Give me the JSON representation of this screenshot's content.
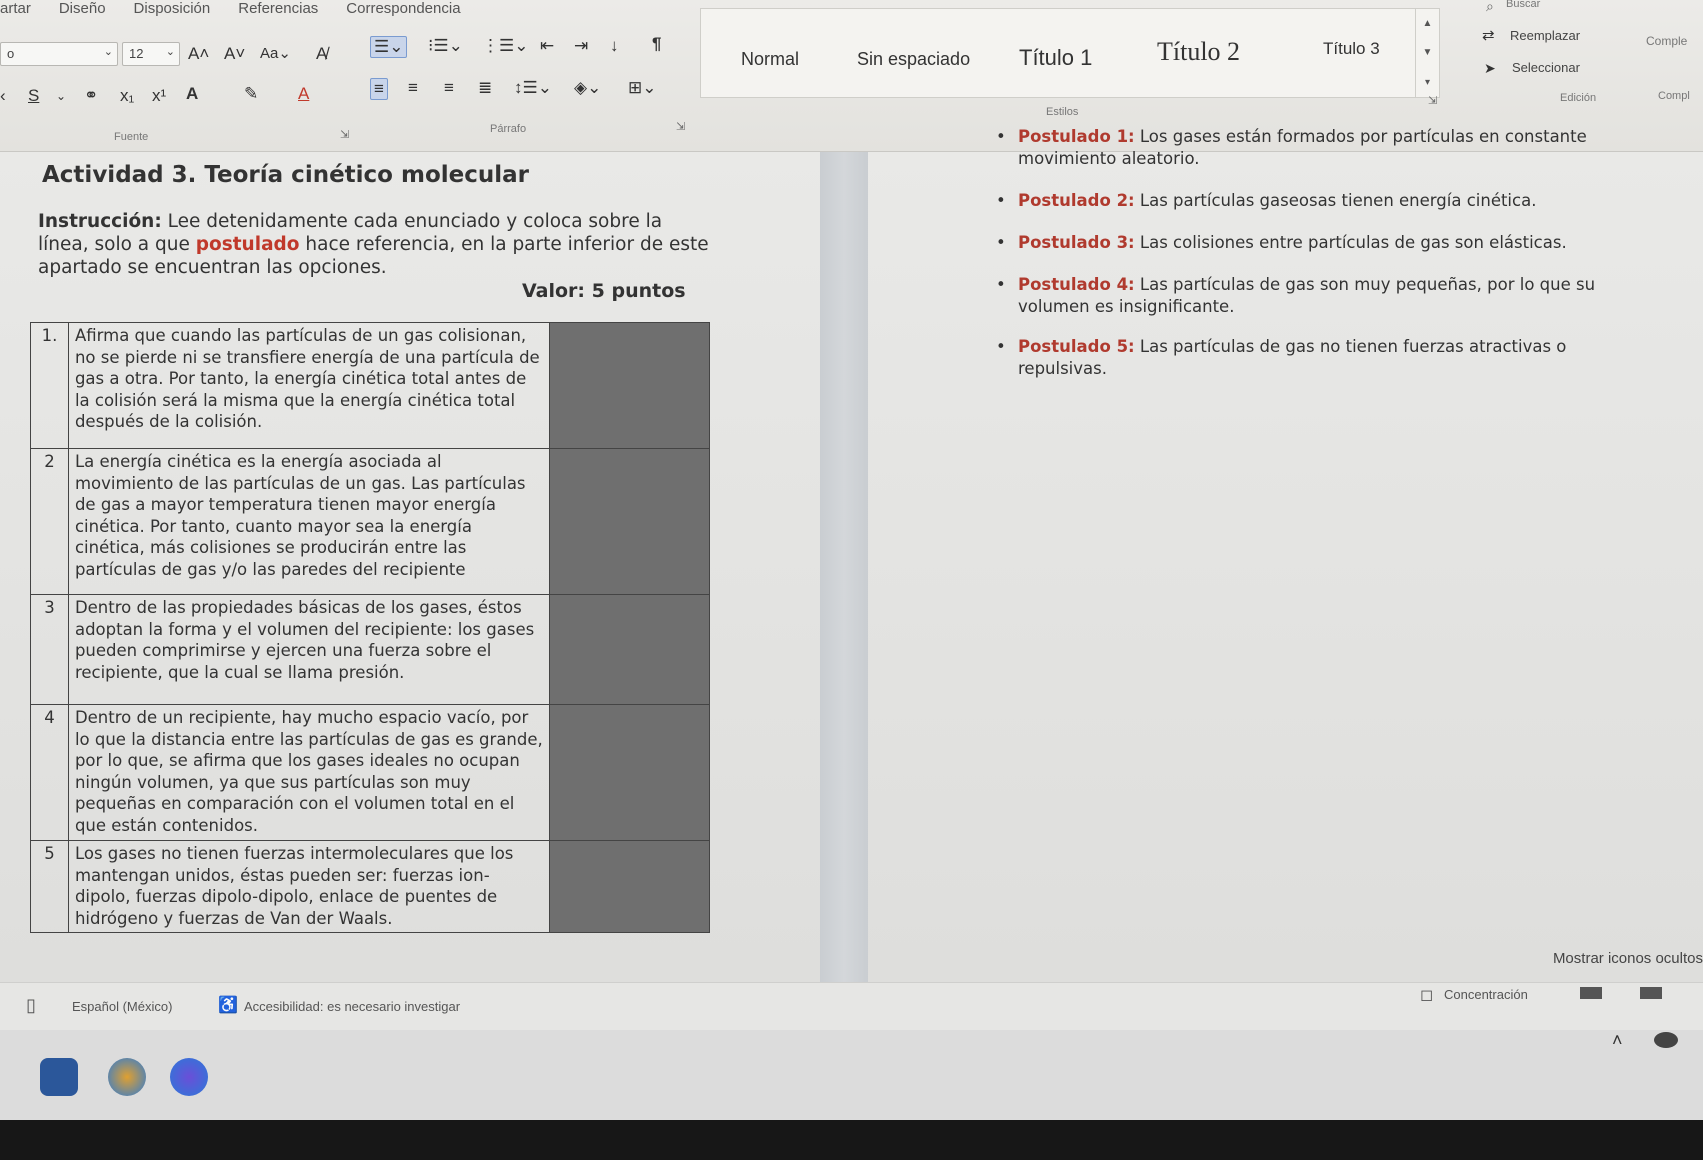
{
  "ribbon": {
    "tabs": [
      "artar",
      "Diseño",
      "Disposición",
      "Referencias",
      "Correspondencia"
    ],
    "font": {
      "name": "o",
      "size": "12",
      "group_label": "Fuente"
    },
    "paragraph": {
      "group_label": "Párrafo"
    },
    "styles": {
      "items": [
        "Normal",
        "Sin espaciado",
        "Título 1",
        "Título 2",
        "Título 3"
      ],
      "group_label": "Estilos"
    },
    "editing": {
      "search": "Buscar",
      "replace": "Reemplazar",
      "select": "Seleccionar",
      "group_label": "Edición"
    },
    "right_cut": {
      "label_top": "Comple",
      "label_bottom": "Compl"
    }
  },
  "document": {
    "title": "Actividad 3. Teoría cinético molecular",
    "instruction": {
      "lead": "Instrucción:",
      "text_1": "Lee detenidamente cada enunciado y coloca sobre la línea, solo a que",
      "keyword": "postulado",
      "text_2": "hace referencia, en la parte inferior de este apartado se encuentran las opciones."
    },
    "value": "Valor: 5 puntos",
    "rows": [
      {
        "num": "1.",
        "text": "Afirma que cuando las partículas de un gas colisionan, no se pierde ni se transfiere energía de una partícula de gas a otra. Por tanto, la energía cinética total antes de la colisión será la misma que la energía cinética total después de la colisión."
      },
      {
        "num": "2",
        "text": "La energía cinética es la energía asociada al movimiento de las partículas de un gas. Las partículas de gas a mayor temperatura tienen mayor energía cinética. Por tanto, cuanto mayor sea la energía cinética, más colisiones se producirán entre las partículas de gas y/o las paredes del recipiente"
      },
      {
        "num": "3",
        "text": "Dentro de las propiedades básicas de los gases, éstos adoptan la forma y el volumen del recipiente: los gases pueden comprimirse y ejercen una fuerza sobre el recipiente, que la cual se llama presión."
      },
      {
        "num": "4",
        "text": "Dentro de un recipiente, hay mucho espacio vacío, por lo que la distancia entre las partículas de gas es grande, por lo que, se afirma que los gases ideales no ocupan ningún volumen, ya que sus partículas son muy pequeñas en comparación con el volumen total en el que están contenidos."
      },
      {
        "num": "5",
        "text": "Los gases no tienen fuerzas intermoleculares que los mantengan unidos, éstas pueden ser: fuerzas ion-dipolo, fuerzas dipolo-dipolo, enlace de puentes de hidrógeno y fuerzas de Van der Waals."
      }
    ],
    "postulates": [
      {
        "label": "Postulado 1:",
        "text": "Los gases están formados por partículas en constante movimiento aleatorio."
      },
      {
        "label": "Postulado 2:",
        "text": "Las partículas gaseosas tienen energía cinética."
      },
      {
        "label": "Postulado 3:",
        "text": "Las colisiones entre partículas de gas son elásticas."
      },
      {
        "label": "Postulado 4:",
        "text": "Las partículas de gas son muy pequeñas, por lo que su volumen es insignificante."
      },
      {
        "label": "Postulado 5:",
        "text": "Las partículas de gas no tienen fuerzas atractivas o repulsivas."
      }
    ],
    "hidden_icons": "Mostrar iconos ocultos"
  },
  "statusbar": {
    "language": "Español (México)",
    "accessibility": "Accesibilidad: es necesario investigar",
    "focus": "Concentración"
  },
  "colors": {
    "keyword_red": "#c0392b",
    "answer_fill": "#6f6f6f",
    "word_blue": "#2b579a"
  }
}
